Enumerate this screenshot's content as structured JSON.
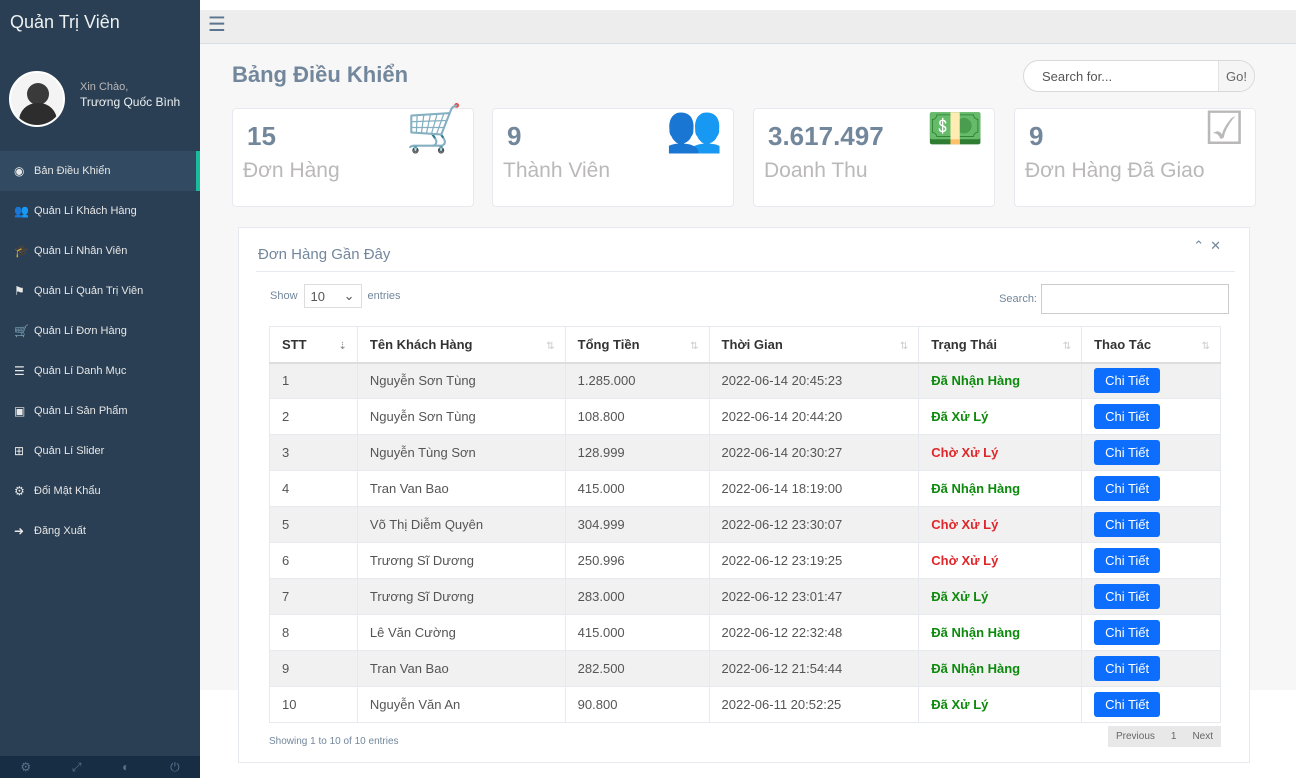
{
  "sidebar": {
    "title": "Quản Trị Viên",
    "greeting": "Xin Chào,",
    "username": "Trương Quốc Bình",
    "items": [
      {
        "label": "Bản Điều Khiển",
        "icon": "dashboard-icon"
      },
      {
        "label": "Quản Lí Khách Hàng",
        "icon": "users-icon"
      },
      {
        "label": "Quản Lí Nhân Viên",
        "icon": "graduation-cap-icon"
      },
      {
        "label": "Quản Lí Quản Trị Viên",
        "icon": "flag-icon"
      },
      {
        "label": "Quản Lí Đơn Hàng",
        "icon": "cart-icon"
      },
      {
        "label": "Quản Lí Danh Mục",
        "icon": "list-icon"
      },
      {
        "label": "Quản Lí Sản Phẩm",
        "icon": "product-icon"
      },
      {
        "label": "Quản Lí Slider",
        "icon": "slider-icon"
      },
      {
        "label": "Đổi Mật Khẩu",
        "icon": "gear-icon"
      },
      {
        "label": "Đăng Xuất",
        "icon": "sign-out-icon"
      }
    ]
  },
  "header": {
    "page_title": "Bảng Điều Khiển",
    "search_placeholder": "Search for...",
    "search_button": "Go!"
  },
  "tiles": [
    {
      "count": "15",
      "label": "Đơn Hàng",
      "icon": "cart-icon"
    },
    {
      "count": "9",
      "label": "Thành Viên",
      "icon": "users-icon"
    },
    {
      "count": "3.617.497",
      "label": "Doanh Thu",
      "icon": "money-icon"
    },
    {
      "count": "9",
      "label": "Đơn Hàng Đã Giao",
      "icon": "check-icon"
    }
  ],
  "panel": {
    "title": "Đơn Hàng Gần Đây",
    "show_label": "Show",
    "length_value": "10",
    "entries_label": "entries",
    "search_label": "Search:",
    "columns": [
      "STT",
      "Tên Khách Hàng",
      "Tổng Tiền",
      "Thời Gian",
      "Trạng Thái",
      "Thao Tác"
    ],
    "rows": [
      {
        "stt": "1",
        "name": "Nguyễn Sơn Tùng",
        "total": "1.285.000",
        "time": "2022-06-14 20:45:23",
        "status": "Đã Nhận Hàng",
        "status_type": "received",
        "action": "Chi Tiết"
      },
      {
        "stt": "2",
        "name": "Nguyễn Sơn Tùng",
        "total": "108.800",
        "time": "2022-06-14 20:44:20",
        "status": "Đã Xử Lý",
        "status_type": "processed",
        "action": "Chi Tiết"
      },
      {
        "stt": "3",
        "name": "Nguyễn Tùng Sơn",
        "total": "128.999",
        "time": "2022-06-14 20:30:27",
        "status": "Chờ Xử Lý",
        "status_type": "pending",
        "action": "Chi Tiết"
      },
      {
        "stt": "4",
        "name": "Tran Van Bao",
        "total": "415.000",
        "time": "2022-06-14 18:19:00",
        "status": "Đã Nhận Hàng",
        "status_type": "received",
        "action": "Chi Tiết"
      },
      {
        "stt": "5",
        "name": "Võ Thị Diễm Quyên",
        "total": "304.999",
        "time": "2022-06-12 23:30:07",
        "status": "Chờ Xử Lý",
        "status_type": "pending",
        "action": "Chi Tiết"
      },
      {
        "stt": "6",
        "name": "Trương Sĩ Dương",
        "total": "250.996",
        "time": "2022-06-12 23:19:25",
        "status": "Chờ Xử Lý",
        "status_type": "pending",
        "action": "Chi Tiết"
      },
      {
        "stt": "7",
        "name": "Trương Sĩ Dương",
        "total": "283.000",
        "time": "2022-06-12 23:01:47",
        "status": "Đã Xử Lý",
        "status_type": "processed",
        "action": "Chi Tiết"
      },
      {
        "stt": "8",
        "name": "Lê Văn Cường",
        "total": "415.000",
        "time": "2022-06-12 22:32:48",
        "status": "Đã Nhận Hàng",
        "status_type": "received",
        "action": "Chi Tiết"
      },
      {
        "stt": "9",
        "name": "Tran Van Bao",
        "total": "282.500",
        "time": "2022-06-12 21:54:44",
        "status": "Đã Nhận Hàng",
        "status_type": "received",
        "action": "Chi Tiết"
      },
      {
        "stt": "10",
        "name": "Nguyễn Văn An",
        "total": "90.800",
        "time": "2022-06-11 20:52:25",
        "status": "Đã Xử Lý",
        "status_type": "processed",
        "action": "Chi Tiết"
      }
    ],
    "showing_text": "Showing 1 to 10 of 10 entries",
    "pager": {
      "previous": "Previous",
      "page": "1",
      "next": "Next"
    }
  },
  "colors": {
    "sidebar_bg": "#2a3f54",
    "accent": "#1abb9c",
    "button_blue": "#0d6efd",
    "status_green": "#0b8a0b",
    "status_red": "#e0262a"
  }
}
